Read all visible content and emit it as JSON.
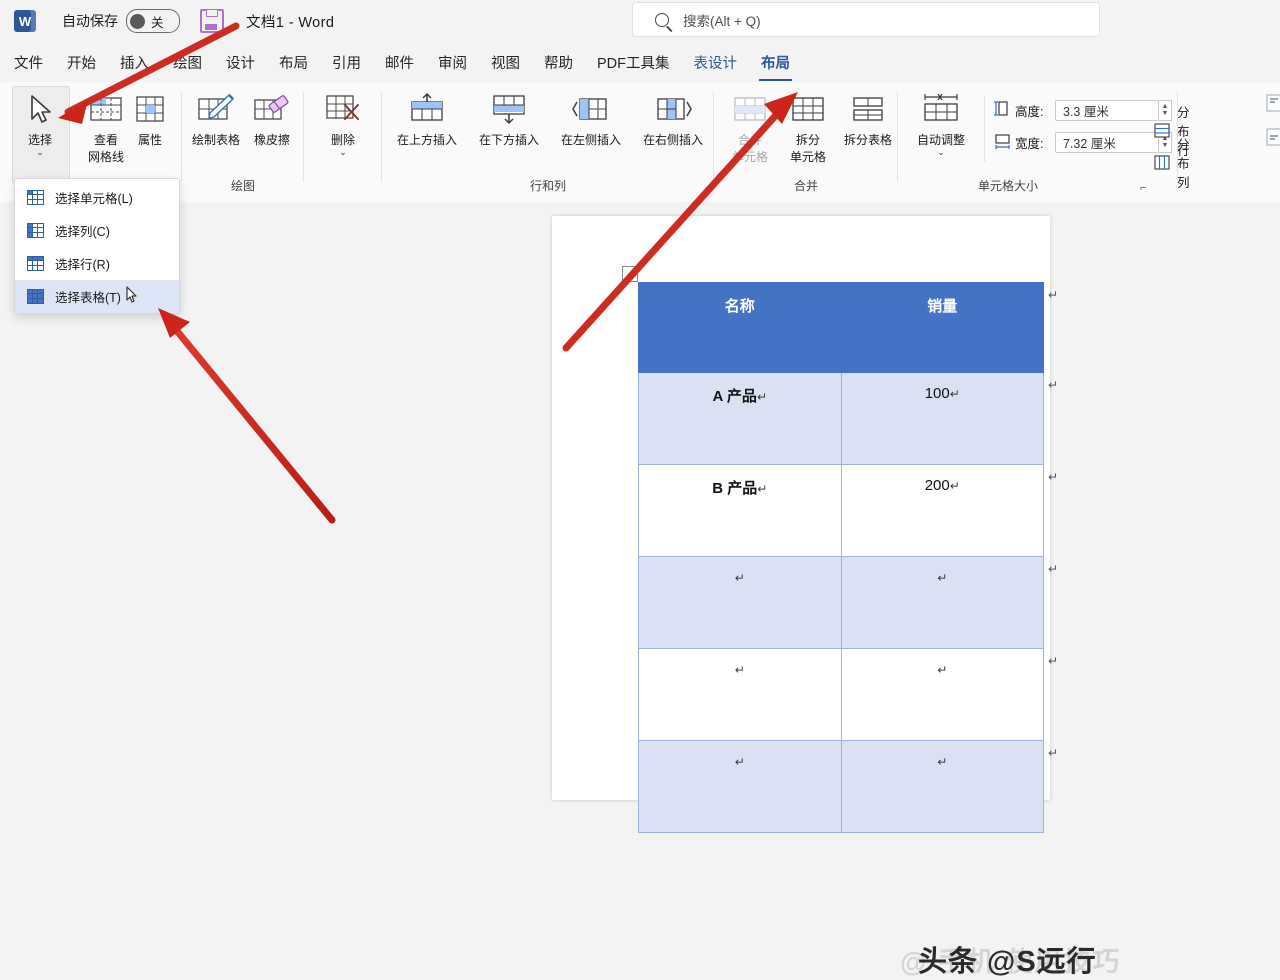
{
  "titlebar": {
    "app_icon": "word-logo-icon",
    "autosave_label": "自动保存",
    "toggle_state": "关",
    "save_icon": "save-icon",
    "document_title": "文档1  -  Word",
    "search_placeholder": "搜索(Alt + Q)"
  },
  "tabs": [
    {
      "label": "文件",
      "state": "normal"
    },
    {
      "label": "开始",
      "state": "normal"
    },
    {
      "label": "插入",
      "state": "normal"
    },
    {
      "label": "绘图",
      "state": "normal"
    },
    {
      "label": "设计",
      "state": "normal"
    },
    {
      "label": "布局",
      "state": "normal"
    },
    {
      "label": "引用",
      "state": "normal"
    },
    {
      "label": "邮件",
      "state": "normal"
    },
    {
      "label": "审阅",
      "state": "normal"
    },
    {
      "label": "视图",
      "state": "normal"
    },
    {
      "label": "帮助",
      "state": "normal"
    },
    {
      "label": "PDF工具集",
      "state": "normal"
    },
    {
      "label": "表设计",
      "state": "contextual"
    },
    {
      "label": "布局",
      "state": "active"
    }
  ],
  "ribbon": {
    "groups": [
      {
        "name": "table",
        "label": ""
      },
      {
        "name": "draw",
        "label": "绘图"
      },
      {
        "name": "rows_cols",
        "label": "行和列"
      },
      {
        "name": "merge",
        "label": "合并"
      },
      {
        "name": "cell_size",
        "label": "单元格大小"
      }
    ],
    "select_button": {
      "label": "选择",
      "caret": "⌄"
    },
    "view_gridlines": {
      "line1": "查看",
      "line2": "网格线"
    },
    "properties": {
      "label": "属性"
    },
    "draw_table": {
      "label": "绘制表格"
    },
    "eraser": {
      "label": "橡皮擦"
    },
    "delete": {
      "label": "删除",
      "caret": "⌄"
    },
    "insert_above": {
      "label": "在上方插入"
    },
    "insert_below": {
      "label": "在下方插入"
    },
    "insert_left": {
      "label": "在左侧插入"
    },
    "insert_right": {
      "label": "在右侧插入"
    },
    "merge_cells": {
      "line1": "合并",
      "line2": "单元格",
      "disabled": true
    },
    "split_cells": {
      "line1": "拆分",
      "line2": "单元格"
    },
    "split_table": {
      "label": "拆分表格"
    },
    "autofit": {
      "label": "自动调整",
      "caret": "⌄"
    },
    "height": {
      "label": "高度:",
      "value": "3.3 厘米"
    },
    "width": {
      "label": "宽度:",
      "value": "7.32 厘米"
    },
    "distribute_rows": {
      "label": "分布行"
    },
    "distribute_cols": {
      "label": "分布列"
    },
    "dialog_launcher": "⌐"
  },
  "select_menu": {
    "items": [
      {
        "label": "选择单元格(L)",
        "highlighted": false
      },
      {
        "label": "选择列(C)",
        "highlighted": false
      },
      {
        "label": "选择行(R)",
        "highlighted": false
      },
      {
        "label": "选择表格(T)",
        "highlighted": true
      }
    ]
  },
  "document": {
    "table": {
      "headers": [
        "名称",
        "销量"
      ],
      "rows": [
        {
          "cells": [
            "A 产品",
            "100"
          ],
          "band": true,
          "empty": false
        },
        {
          "cells": [
            "B 产品",
            "200"
          ],
          "band": false,
          "empty": false
        },
        {
          "cells": [
            "",
            ""
          ],
          "band": true,
          "empty": true
        },
        {
          "cells": [
            "",
            ""
          ],
          "band": false,
          "empty": true
        },
        {
          "cells": [
            "",
            ""
          ],
          "band": true,
          "empty": true
        }
      ],
      "pilcrow": "↵",
      "header_color": "#4472C4",
      "band_color": "#D9E1F2"
    }
  },
  "watermark": {
    "text": "头条 @S远行",
    "ghost_text": "@ 手机 使用技巧"
  }
}
